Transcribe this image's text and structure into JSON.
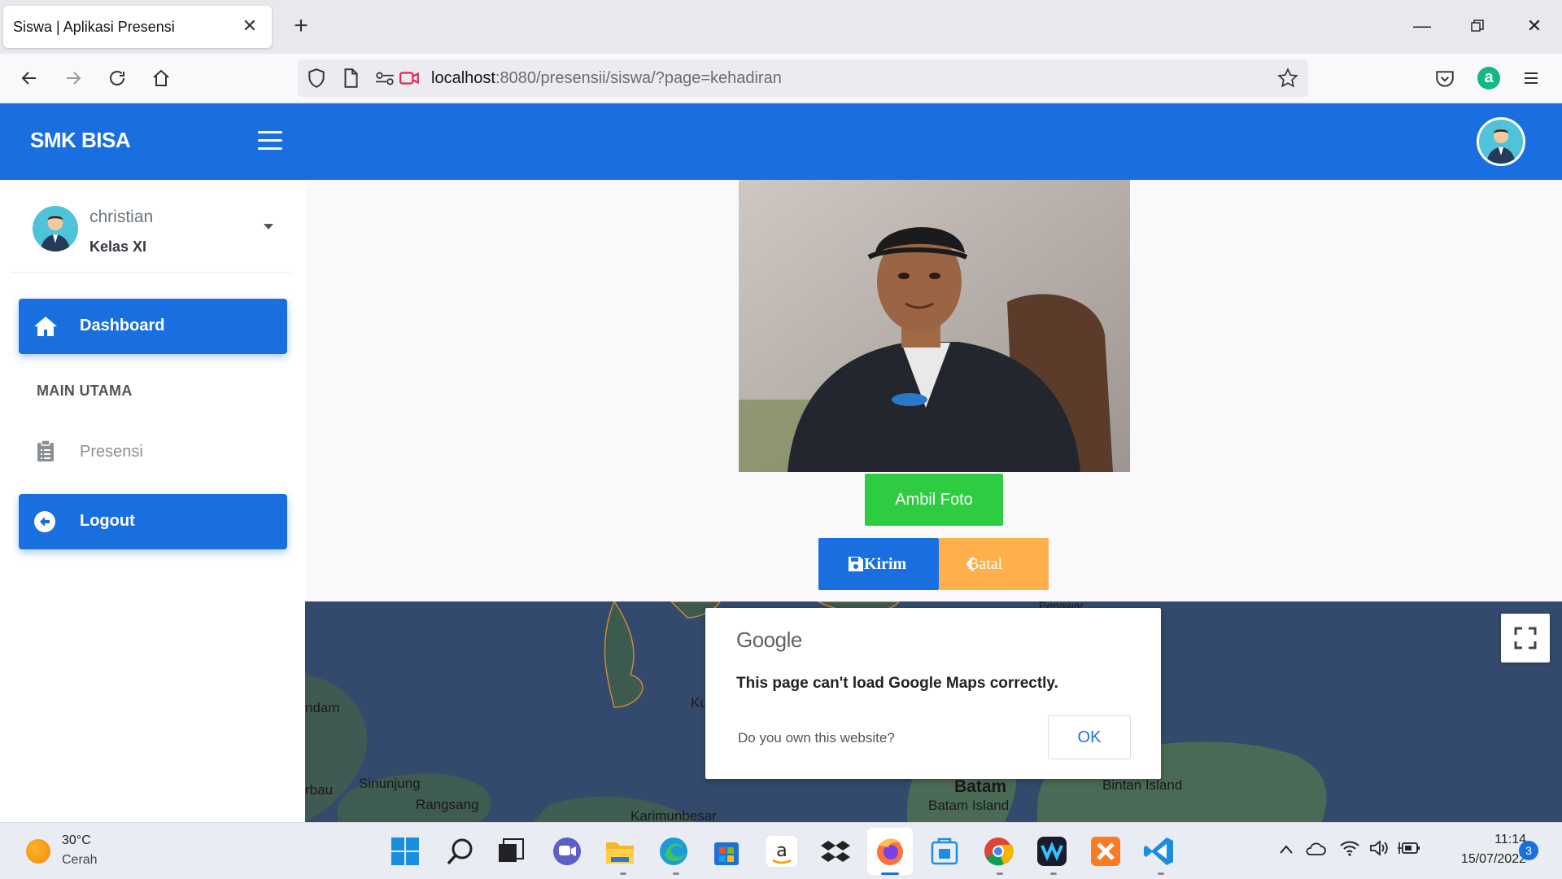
{
  "browser": {
    "tab_title": "Siswa | Aplikasi Presensi",
    "url_host": "localhost",
    "url_path": ":8080/presensii/siswa/?page=kehadiran"
  },
  "app": {
    "brand": "SMK BISA",
    "accent_color": "#1a6fe0"
  },
  "sidebar": {
    "user_name": "christian",
    "user_class": "Kelas XI",
    "dashboard_label": "Dashboard",
    "section_header": "MAIN UTAMA",
    "presensi_label": "Presensi",
    "logout_label": "Logout"
  },
  "main": {
    "ambil_foto_label": "Ambil Foto",
    "kirim_label": "Kirim",
    "batal_label": "Batal"
  },
  "map": {
    "labels": {
      "ndam": "ndam",
      "ku": "Ku",
      "sinunjung": "Sinunjung",
      "rbau": "rbau",
      "rangsang": "Rangsang",
      "karimunbesar": "Karimunbesar",
      "batam": "Batam",
      "batam_island": "Batam Island",
      "bintan_island": "Bintan Island",
      "penawar": "Penawar"
    },
    "dialog": {
      "logo": "Google",
      "message": "This page can't load Google Maps correctly.",
      "question": "Do you own this website?",
      "ok_label": "OK"
    }
  },
  "taskbar": {
    "weather_temp": "30°C",
    "weather_desc": "Cerah",
    "time": "11:14",
    "date": "15/07/2022",
    "notification_count": "3"
  }
}
